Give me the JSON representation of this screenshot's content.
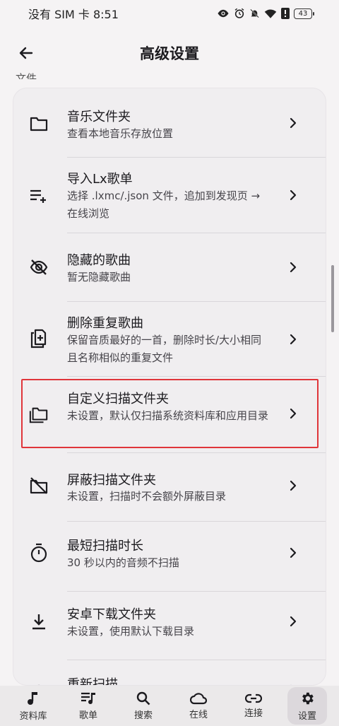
{
  "status_bar": {
    "carrier_time": "没有 SIM 卡 8:51",
    "battery": "43"
  },
  "app_bar": {
    "title": "高级设置",
    "partial_heading": "文件"
  },
  "items": [
    {
      "title": "音乐文件夹",
      "subtitle": "查看本地音乐存放位置",
      "icon": "folder-icon"
    },
    {
      "title": "导入Lx歌单",
      "subtitle": "选择 .lxmc/.json 文件，追加到发现页 → 在线浏览",
      "icon": "playlist-add-icon"
    },
    {
      "title": "隐藏的歌曲",
      "subtitle": "暂无隐藏歌曲",
      "icon": "eye-off-icon"
    },
    {
      "title": "删除重复歌曲",
      "subtitle": "保留音质最好的一首，删除时长/大小相同且名称相似的重复文件",
      "icon": "clipboard-plus-icon"
    },
    {
      "title": "自定义扫描文件夹",
      "subtitle": "未设置，默认仅扫描系统资料库和应用目录",
      "icon": "folders-icon"
    },
    {
      "title": "屏蔽扫描文件夹",
      "subtitle": "未设置，扫描时不会额外屏蔽目录",
      "icon": "folder-off-icon"
    },
    {
      "title": "最短扫描时长",
      "subtitle": "30 秒以内的音频不扫描",
      "icon": "timer-icon"
    },
    {
      "title": "安卓下载文件夹",
      "subtitle": "未设置，使用默认下载目录",
      "icon": "download-icon"
    },
    {
      "title": "重新扫描",
      "subtitle": "",
      "icon": "refresh-icon"
    }
  ],
  "bottom_nav": [
    {
      "label": "资料库",
      "icon": "music-note-icon"
    },
    {
      "label": "歌单",
      "icon": "queue-music-icon"
    },
    {
      "label": "搜索",
      "icon": "search-icon"
    },
    {
      "label": "在线",
      "icon": "cloud-icon"
    },
    {
      "label": "连接",
      "icon": "link-icon"
    },
    {
      "label": "设置",
      "icon": "gear-icon",
      "active": true
    }
  ],
  "colors": {
    "background": "#f5f3f4",
    "card": "#f0eef0",
    "highlight": "#e0353a",
    "nav_active": "#dcd8dc"
  }
}
